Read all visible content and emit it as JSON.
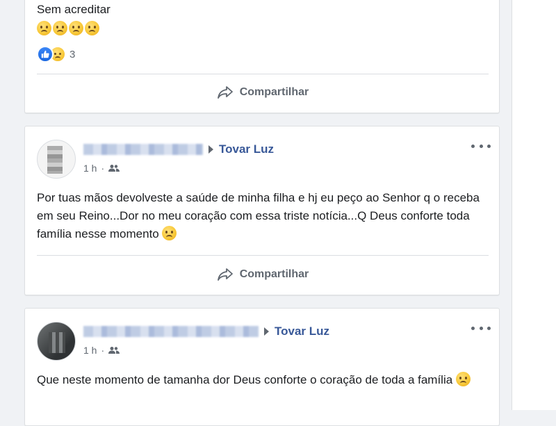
{
  "posts": [
    {
      "text": "Sem acreditar",
      "emoji_line": [
        "sad-emoji",
        "sad-emoji",
        "sad-emoji",
        "sad-emoji"
      ],
      "reactions": {
        "icons": [
          "like-icon",
          "sad-reaction-icon"
        ],
        "count": "3"
      },
      "share_label": "Compartilhar"
    },
    {
      "group": "Tovar Luz",
      "time": "1 h",
      "privacy_icon": "group-icon",
      "text": "Por tuas mãos devolveste a saúde de minha filha e hj eu peço ao Senhor q o receba em seu Reino...Dor no meu coração com essa triste notícia...Q Deus conforte toda família nesse momento",
      "share_label": "Compartilhar"
    },
    {
      "group": "Tovar Luz",
      "time": "1 h",
      "privacy_icon": "group-icon",
      "text": "Que neste momento de tamanha dor Deus conforte o coração de toda a família"
    }
  ],
  "colors": {
    "link_blue": "#385898",
    "like_blue": "#1a67e0",
    "text_secondary": "#606770",
    "background": "#f0f2f5"
  }
}
